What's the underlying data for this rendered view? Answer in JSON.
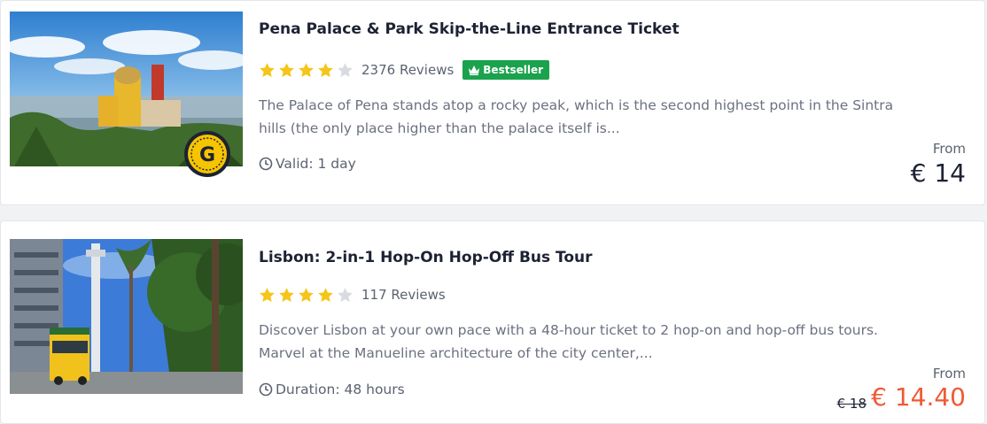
{
  "listings": [
    {
      "title": "Pena Palace & Park Skip-the-Line Entrance Ticket",
      "rating": 4,
      "reviews": "2376 Reviews",
      "badge": "Bestseller",
      "description": "The Palace of Pena stands atop a rocky peak, which is the second highest point in the Sintra hills (the only place higher than the palace itself is...",
      "meta_label": "Valid: 1 day",
      "from_label": "From",
      "price": "€ 14",
      "image_icon": "pena-palace-photo",
      "guarantee_icon": "g-coin-icon"
    },
    {
      "title": "Lisbon: 2-in-1 Hop-On Hop-Off Bus Tour",
      "rating": 4,
      "reviews": "117 Reviews",
      "description": "Discover Lisbon at your own pace with a 48-hour ticket to 2 hop-on and hop-off bus tours. Marvel at the Manueline architecture of the city center,...",
      "meta_label": "Duration: 48 hours",
      "from_label": "From",
      "old_price": "€ 18",
      "price": "€ 14.40",
      "image_icon": "lisbon-bus-photo"
    }
  ],
  "colors": {
    "star_filled": "#f5c518",
    "star_empty": "#d8dbe0",
    "bestseller": "#1ba24d",
    "sale_price": "#ef5a35",
    "text_dark": "#1d2233",
    "text_muted": "#6b7180"
  }
}
